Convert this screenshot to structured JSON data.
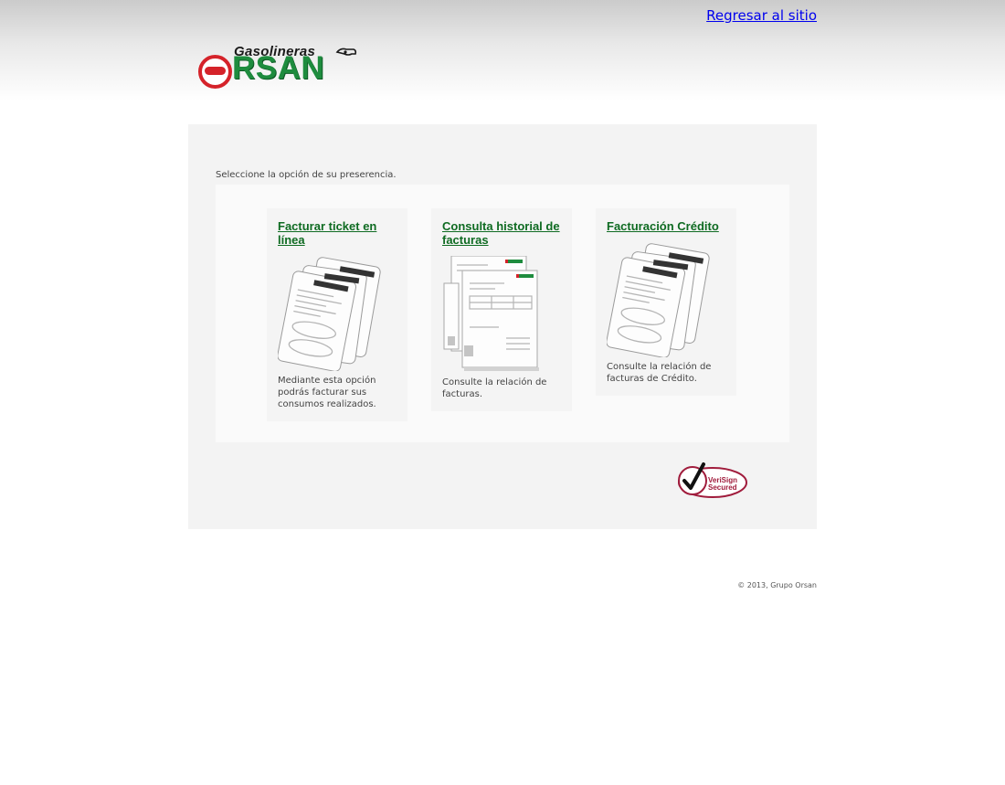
{
  "header": {
    "back_link": "Regresar al sitio",
    "logo": {
      "top_text": "Gasolineras",
      "main_text": "RSAN",
      "brand_red": "#d5232a",
      "brand_green": "#1e8c3e"
    }
  },
  "main": {
    "instruction": "Seleccione la opción de su preserencia.",
    "cards": [
      {
        "title": "Facturar ticket en línea",
        "description": "Mediante esta opción podrás facturar sus consumos realizados.",
        "icon": "tickets-image"
      },
      {
        "title": "Consulta historial de facturas",
        "description": "Consulte la relación de facturas.",
        "icon": "invoices-image"
      },
      {
        "title": "Facturación Crédito",
        "description": "Consulte la relación de facturas de Crédito.",
        "icon": "tickets-image"
      }
    ],
    "verisign": {
      "line1": "VeriSign",
      "line2": "Secured",
      "accent": "#a01c3c"
    }
  },
  "footer": {
    "copyright": "© 2013, Grupo Orsan"
  },
  "colors": {
    "link_green": "#0f6b22",
    "panel_bg": "#f3f3f3",
    "inner_bg": "#fafafa"
  }
}
